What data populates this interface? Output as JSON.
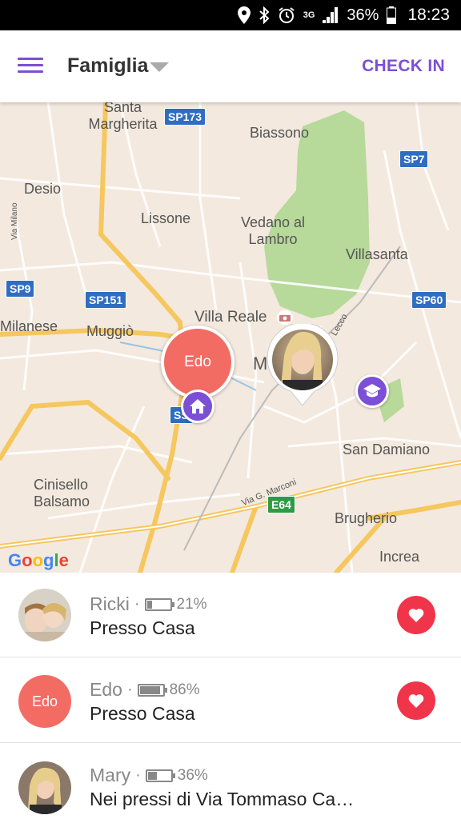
{
  "status_bar": {
    "signal_type": "3G",
    "battery": "36%",
    "time": "18:23"
  },
  "app_bar": {
    "group_name": "Famiglia",
    "check_in_label": "CHECK IN"
  },
  "map": {
    "places": [
      "Santa Margherita",
      "Biassono",
      "Desio",
      "Lissone",
      "Vedano al Lambro",
      "Villasanta",
      "Milanese",
      "Muggiò",
      "Villa Reale",
      "M",
      "San Damiano",
      "Cinisello Balsamo",
      "Brugherio",
      "Increa",
      "Via Milano",
      "Via G. Marconi",
      "Lecco"
    ],
    "roads": [
      "SP173",
      "SP7",
      "SP9",
      "SP151",
      "SP60",
      "SS",
      "E64"
    ],
    "google_logo": "Google",
    "edo_pin_label": "Edo"
  },
  "members": [
    {
      "name": "Ricki",
      "battery": "21%",
      "battery_level": 0.21,
      "status": "Presso Casa"
    },
    {
      "name": "Edo",
      "battery": "86%",
      "battery_level": 0.86,
      "status": "Presso Casa",
      "initial": "Edo"
    },
    {
      "name": "Mary",
      "battery": "36%",
      "battery_level": 0.36,
      "status": "Nei pressi di Via Tommaso Ca…"
    }
  ],
  "colors": {
    "accent": "#7b4fd6",
    "edo": "#f26c64",
    "heart": "#f0354a",
    "park": "#a8d18d"
  }
}
